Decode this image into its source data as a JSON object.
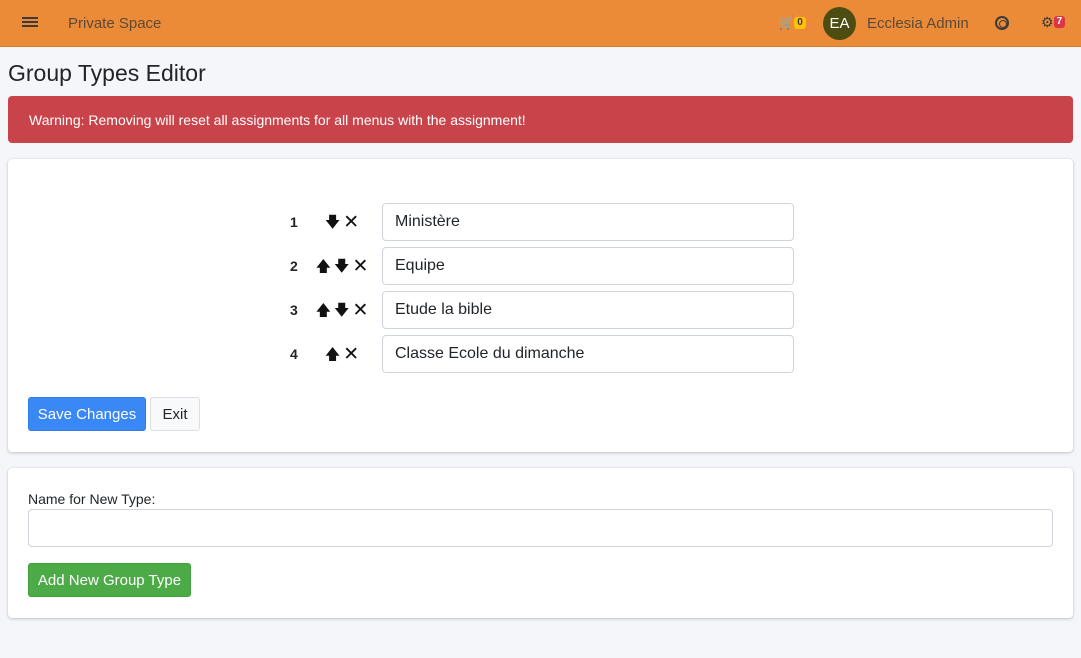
{
  "navbar": {
    "brand": "Private Space",
    "cart_count": "0",
    "user_initials": "EA",
    "user_name": "Ecclesia Admin",
    "settings_count": "7",
    "icons": [
      "menu-icon",
      "cart-icon",
      "help-icon",
      "gear-icon"
    ]
  },
  "page": {
    "title": "Group Types Editor"
  },
  "alert": {
    "text": "Warning: Removing will reset all assignments for all menus with the assignment!"
  },
  "group_types": [
    {
      "number": "1",
      "name": "Ministère",
      "can_up": false,
      "can_down": true
    },
    {
      "number": "2",
      "name": "Equipe",
      "can_up": true,
      "can_down": true
    },
    {
      "number": "3",
      "name": "Etude la bible",
      "can_up": true,
      "can_down": true
    },
    {
      "number": "4",
      "name": "Classe Ecole du dimanche",
      "can_up": true,
      "can_down": false
    }
  ],
  "glyphs": {
    "up": "🡅",
    "down": "🡇",
    "remove": "✕"
  },
  "actions": {
    "save_label": "Save Changes",
    "exit_label": "Exit"
  },
  "new_type": {
    "label": "Name for New Type:",
    "value": "",
    "add_label": "Add New Group Type"
  },
  "colors": {
    "navbar": "#eb8b38",
    "alert": "#c9434a",
    "primary": "#3a87f6",
    "success": "#4caa47",
    "avatar": "#4d4d12"
  }
}
